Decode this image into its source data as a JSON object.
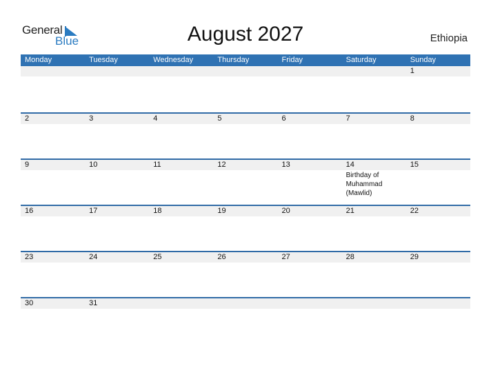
{
  "logo": {
    "general": "General",
    "blue": "Blue"
  },
  "title": "August 2027",
  "country": "Ethiopia",
  "colors": {
    "accent": "#2f72b3",
    "band": "#f0f0f0"
  },
  "weekdays": [
    "Monday",
    "Tuesday",
    "Wednesday",
    "Thursday",
    "Friday",
    "Saturday",
    "Sunday"
  ],
  "weeks": [
    [
      {
        "day": ""
      },
      {
        "day": ""
      },
      {
        "day": ""
      },
      {
        "day": ""
      },
      {
        "day": ""
      },
      {
        "day": ""
      },
      {
        "day": "1"
      }
    ],
    [
      {
        "day": "2"
      },
      {
        "day": "3"
      },
      {
        "day": "4"
      },
      {
        "day": "5"
      },
      {
        "day": "6"
      },
      {
        "day": "7"
      },
      {
        "day": "8"
      }
    ],
    [
      {
        "day": "9"
      },
      {
        "day": "10"
      },
      {
        "day": "11"
      },
      {
        "day": "12"
      },
      {
        "day": "13"
      },
      {
        "day": "14",
        "event": "Birthday of Muhammad (Mawlid)"
      },
      {
        "day": "15"
      }
    ],
    [
      {
        "day": "16"
      },
      {
        "day": "17"
      },
      {
        "day": "18"
      },
      {
        "day": "19"
      },
      {
        "day": "20"
      },
      {
        "day": "21"
      },
      {
        "day": "22"
      }
    ],
    [
      {
        "day": "23"
      },
      {
        "day": "24"
      },
      {
        "day": "25"
      },
      {
        "day": "26"
      },
      {
        "day": "27"
      },
      {
        "day": "28"
      },
      {
        "day": "29"
      }
    ],
    [
      {
        "day": "30"
      },
      {
        "day": "31"
      },
      {
        "day": ""
      },
      {
        "day": ""
      },
      {
        "day": ""
      },
      {
        "day": ""
      },
      {
        "day": ""
      }
    ]
  ]
}
